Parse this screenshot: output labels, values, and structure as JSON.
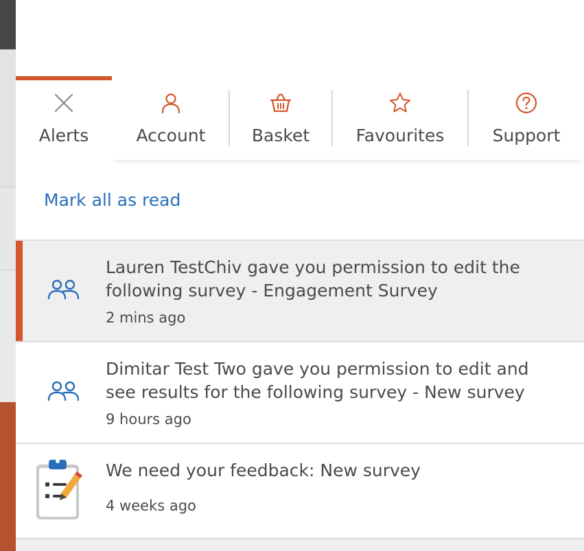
{
  "tabs": [
    {
      "label": "Alerts",
      "icon": "close-icon",
      "active": true
    },
    {
      "label": "Account",
      "icon": "user-icon"
    },
    {
      "label": "Basket",
      "icon": "basket-icon"
    },
    {
      "label": "Favourites",
      "icon": "star-icon"
    },
    {
      "label": "Support",
      "icon": "help-icon"
    }
  ],
  "mark_all_label": "Mark all as read",
  "notifications": [
    {
      "line1": "Lauren TestChiv gave you permission to edit the",
      "line2": "following survey - Engagement Survey",
      "time": "2 mins ago",
      "icon": "users-icon",
      "unread": true
    },
    {
      "line1": "Dimitar Test Two gave you permission to edit and",
      "line2": "see results for the following survey - New survey",
      "time": "9 hours ago",
      "icon": "users-icon",
      "unread": false
    },
    {
      "line1": "We need your feedback: New survey",
      "time": "4 weeks ago",
      "icon": "clipboard-icon",
      "unread": false
    }
  ],
  "colors": {
    "accent": "#d4562d",
    "link": "#2a6ebb",
    "text": "#4a4a4a"
  }
}
